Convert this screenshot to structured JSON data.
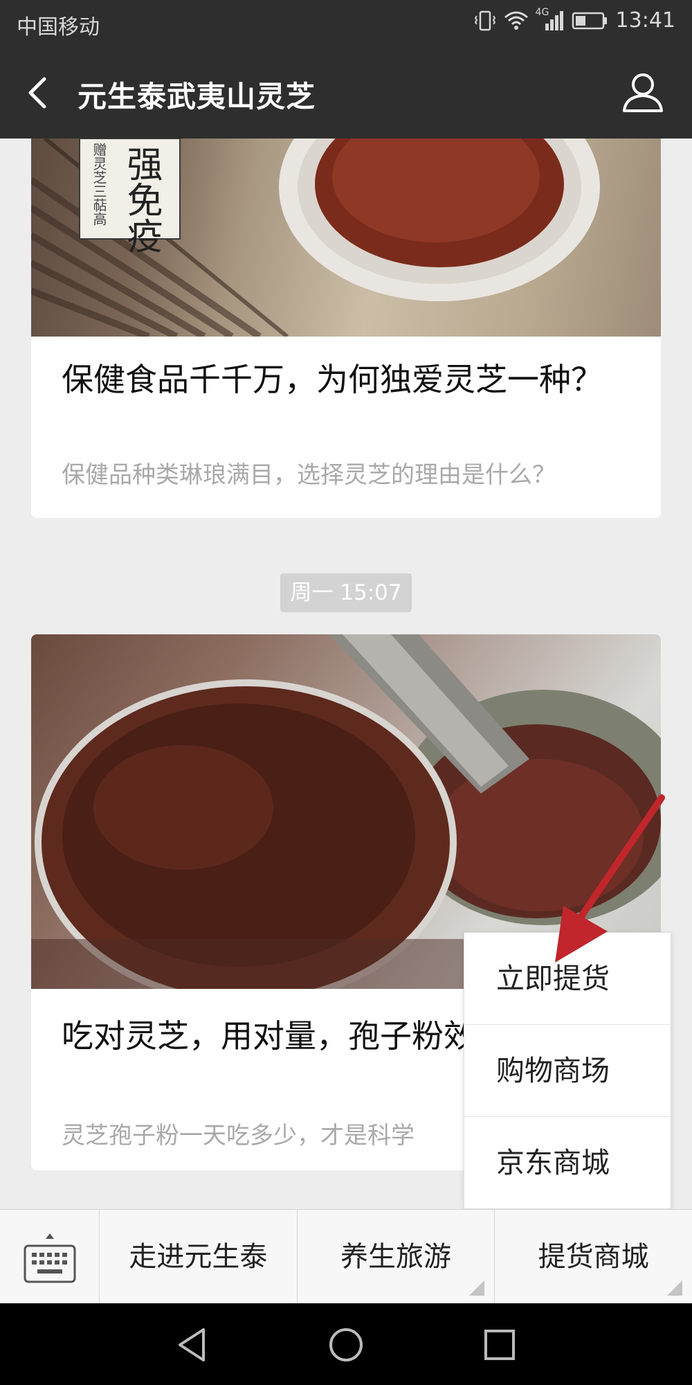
{
  "status_bar": {
    "carrier": "中国移动",
    "network": "4G",
    "time": "13:41"
  },
  "header": {
    "title": "元生泰武夷山灵芝"
  },
  "cards": [
    {
      "image_text": "强免疫",
      "image_side_text": "赠灵芝三萜高",
      "title": "保健食品千千万，为何独爱灵芝一种？",
      "desc": "保健品种类琳琅满目，选择灵芝的理由是什么？"
    },
    {
      "title": "吃对灵芝，用对量，孢子粉效果好！",
      "desc": "灵芝孢子粉一天吃多少，才是科学"
    }
  ],
  "timestamp": "周一 15:07",
  "popup_menu": {
    "items": [
      "立即提货",
      "购物商场",
      "京东商城"
    ]
  },
  "menu_bar": {
    "items": [
      "走进元生泰",
      "养生旅游",
      "提货商城"
    ]
  },
  "colors": {
    "bar_dark": "#2e2e2e",
    "background": "#ededed",
    "arrow": "#c0262b"
  }
}
